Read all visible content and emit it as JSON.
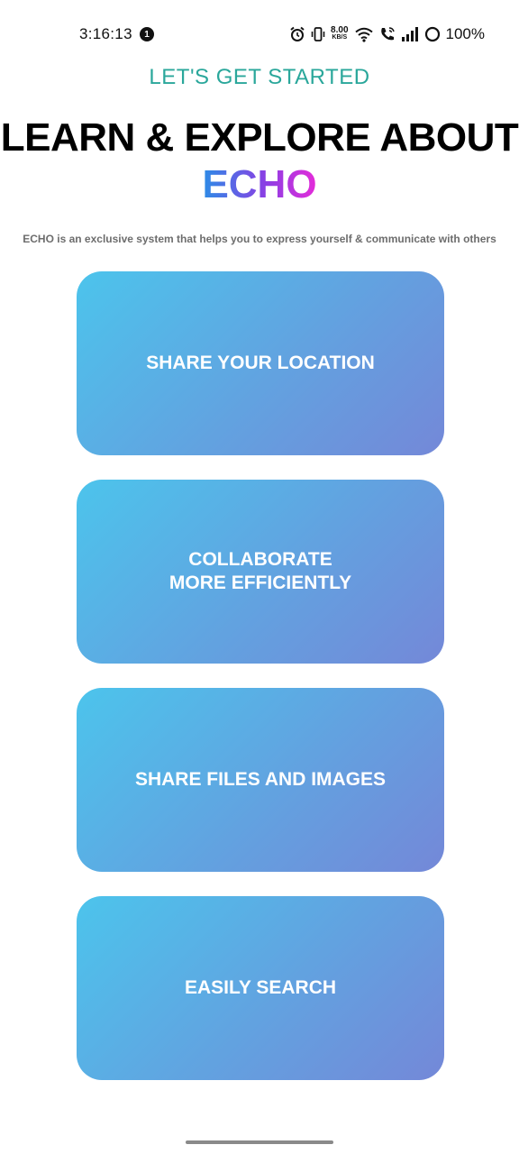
{
  "status_bar": {
    "time": "3:16:13",
    "notification_count": "1",
    "speed_value": "8.00",
    "speed_unit": "KB/S",
    "battery": "100%",
    "icons": [
      "alarm-icon",
      "vibrate-icon",
      "wifi-icon",
      "wifi-calling-icon",
      "signal-icon",
      "battery-icon"
    ]
  },
  "header": {
    "kicker": "LET'S GET STARTED",
    "title": "LEARN & EXPLORE ABOUT",
    "brand": "ECHO",
    "brand_gradient": [
      "#2b8de6",
      "#8a3fe4",
      "#e52bd9"
    ],
    "subtitle": "ECHO is an exclusive system that helps you to express yourself & communicate with others"
  },
  "features": [
    {
      "lines": [
        "SHARE YOUR LOCATION"
      ]
    },
    {
      "lines": [
        "COLLABORATE",
        "MORE EFFICIENTLY"
      ]
    },
    {
      "lines": [
        "SHARE FILES AND IMAGES"
      ]
    },
    {
      "lines": [
        "EASILY SEARCH"
      ]
    }
  ],
  "colors": {
    "kicker": "#2aa79b",
    "card_gradient_start": "#4cc4ec",
    "card_gradient_end": "#7488d8"
  }
}
